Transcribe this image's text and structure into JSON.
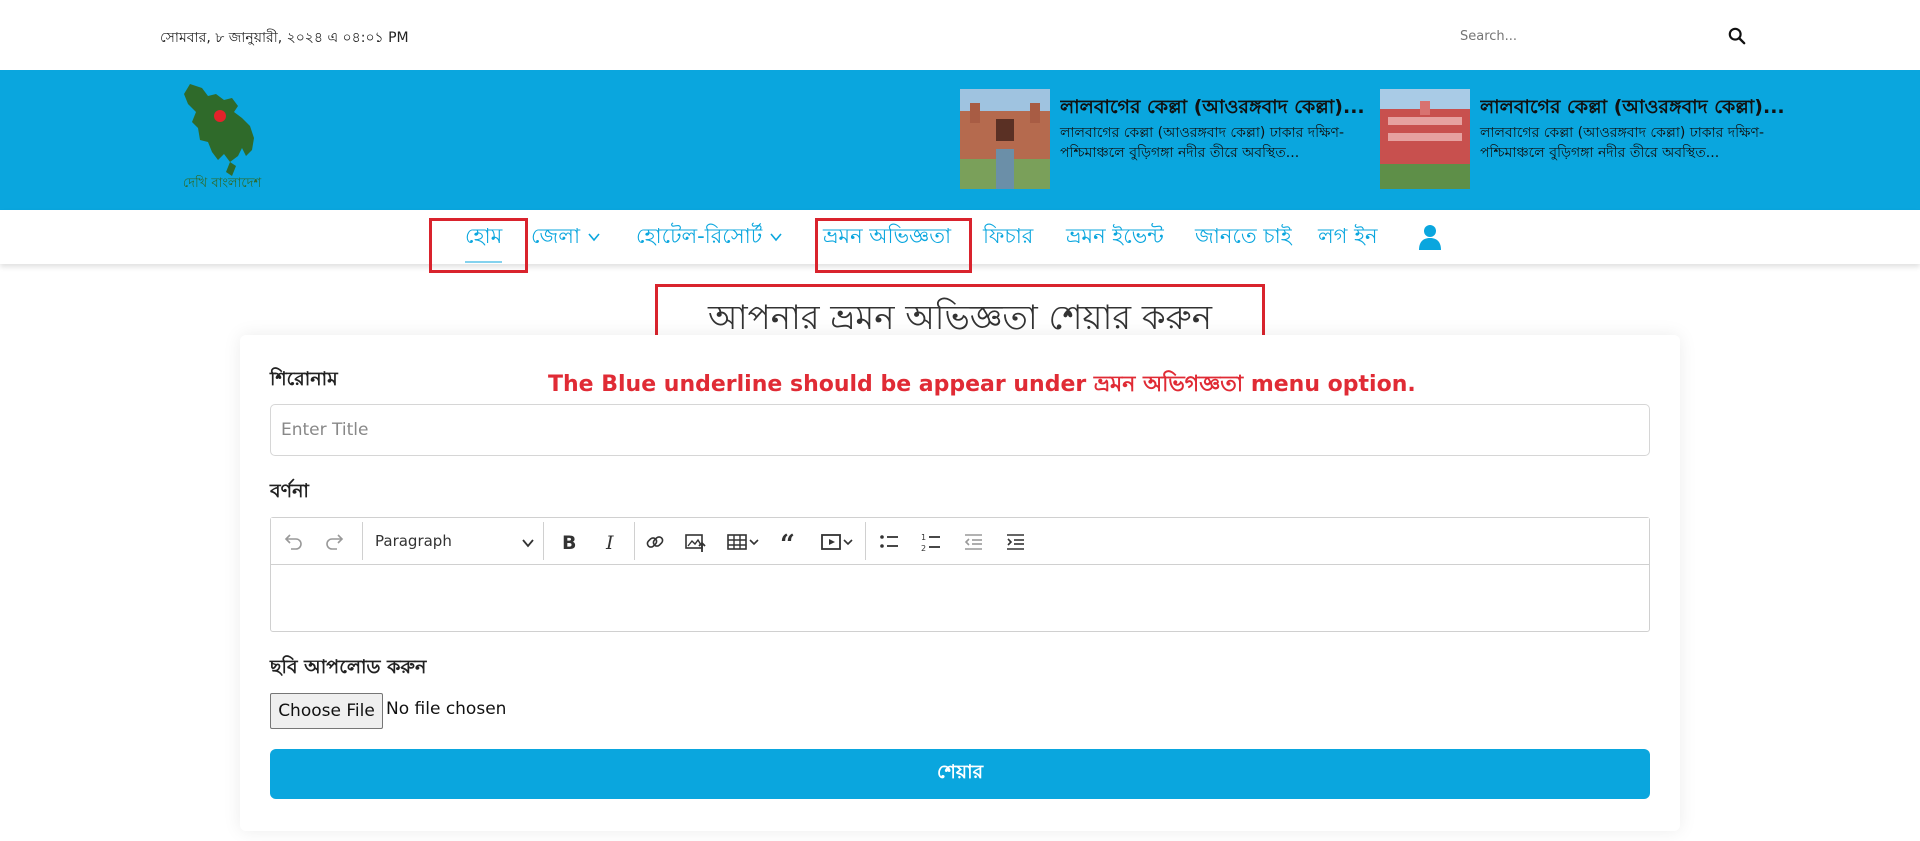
{
  "topbar": {
    "date": "সোমবার, ৮ জানুয়ারী, ২০২৪ এ ০৪:০১ PM",
    "search_placeholder": "Search..."
  },
  "brand": {
    "logo_text": "দেখি বাংলাদেশ"
  },
  "news": [
    {
      "title": "লালবাগের কেল্লা (আওরঙ্গবাদ কেল্লা)...",
      "desc": "লালবাগের কেল্লা (আওরঙ্গবাদ কেল্লা) ঢাকার দক্ষিণ-পশ্চিমাঞ্চলে বুড়িগঙ্গা নদীর তীরে অবস্থিত..."
    },
    {
      "title": "লালবাগের কেল্লা (আওরঙ্গবাদ কেল্লা)...",
      "desc": "লালবাগের কেল্লা (আওরঙ্গবাদ কেল্লা) ঢাকার দক্ষিণ-পশ্চিমাঞ্চলে বুড়িগঙ্গা নদীর তীরে অবস্থিত..."
    }
  ],
  "nav": {
    "items": [
      {
        "label": "হোম",
        "active": true
      },
      {
        "label": "জেলা",
        "dropdown": true
      },
      {
        "label": "হোটেল-রিসোর্ট",
        "dropdown": true
      },
      {
        "label": "ভ্রমন অভিজ্ঞতা"
      },
      {
        "label": "ফিচার"
      },
      {
        "label": "ভ্রমন ইভেন্ট"
      },
      {
        "label": "জানতে চাই"
      },
      {
        "label": "লগ ইন"
      }
    ]
  },
  "page": {
    "title": "আপনার ভ্রমন অভিজ্ঞতা শেয়ার করুন"
  },
  "annotation": {
    "text": "The Blue underline should be appear under ভ্রমন অভিগজ্ঞতা menu option."
  },
  "form": {
    "title_label": "শিরোনাম",
    "title_placeholder": "Enter Title",
    "title_value": "",
    "description_label": "বর্ণনা",
    "editor_paragraph": "Paragraph",
    "upload_label": "ছবি আপলোড করুন",
    "choose_file": "Choose File",
    "no_file": "No file chosen",
    "submit": "শেয়ার"
  },
  "colors": {
    "accent": "#0aa6de",
    "annotation": "#e02b35",
    "logo_green": "#2f6a2a"
  }
}
